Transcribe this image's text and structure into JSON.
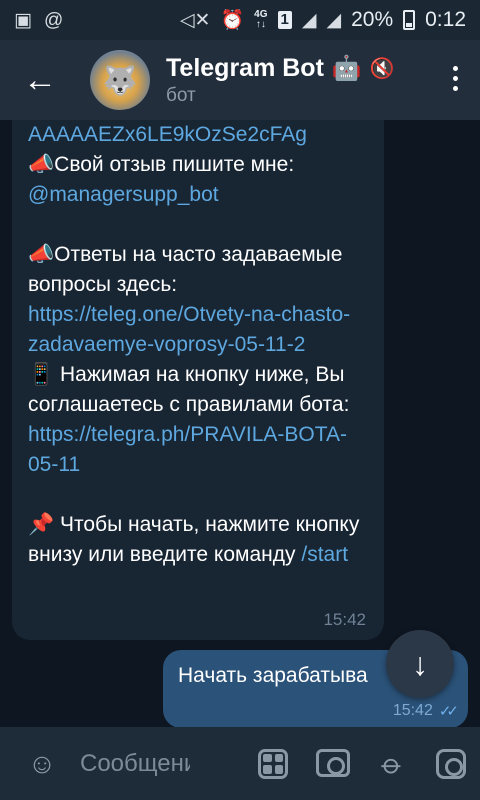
{
  "status_bar": {
    "icons_left": [
      "image-icon",
      "at-icon"
    ],
    "battery_percent": "20%",
    "time": "0:12",
    "network_type": "4G",
    "sim": "1"
  },
  "header": {
    "back_icon": "arrow-left-icon",
    "title": "Telegram Bot",
    "title_emoji": "🤖",
    "subtitle": "бот",
    "menu_icon": "more-vert-icon"
  },
  "messages": {
    "incoming": {
      "line_1": "AAAAAEZx6LE9kOzSe2cFAg",
      "feedback_prefix": "📣Свой отзыв пишите мне:",
      "feedback_link": "@managersupp_bot",
      "faq_prefix": "📣Ответы на часто задаваемые вопросы здесь:",
      "faq_link": "https://teleg.one/Otvety-na-chasto-zadavaemye-voprosy-05-11-2",
      "rules_prefix": "📱 Нажимая на кнопку ниже, Вы соглашаетесь с правилами бота:",
      "rules_link": "https://telegra.ph/PRAVILA-BOTA-05-11",
      "start_prefix": "📌 Чтобы начать, нажмите кнопку внизу или введите команду",
      "start_command": "/start",
      "time": "15:42"
    },
    "outgoing": {
      "text": "Начать зарабатыва",
      "time": "15:42"
    }
  },
  "scroll_down_button": {
    "icon": "arrow-down-icon"
  },
  "input_bar": {
    "placeholder": "Сообщение",
    "icons": [
      "emoji-icon",
      "bot-commands-icon",
      "camera-icon",
      "attach-icon",
      "instagram-icon"
    ]
  }
}
